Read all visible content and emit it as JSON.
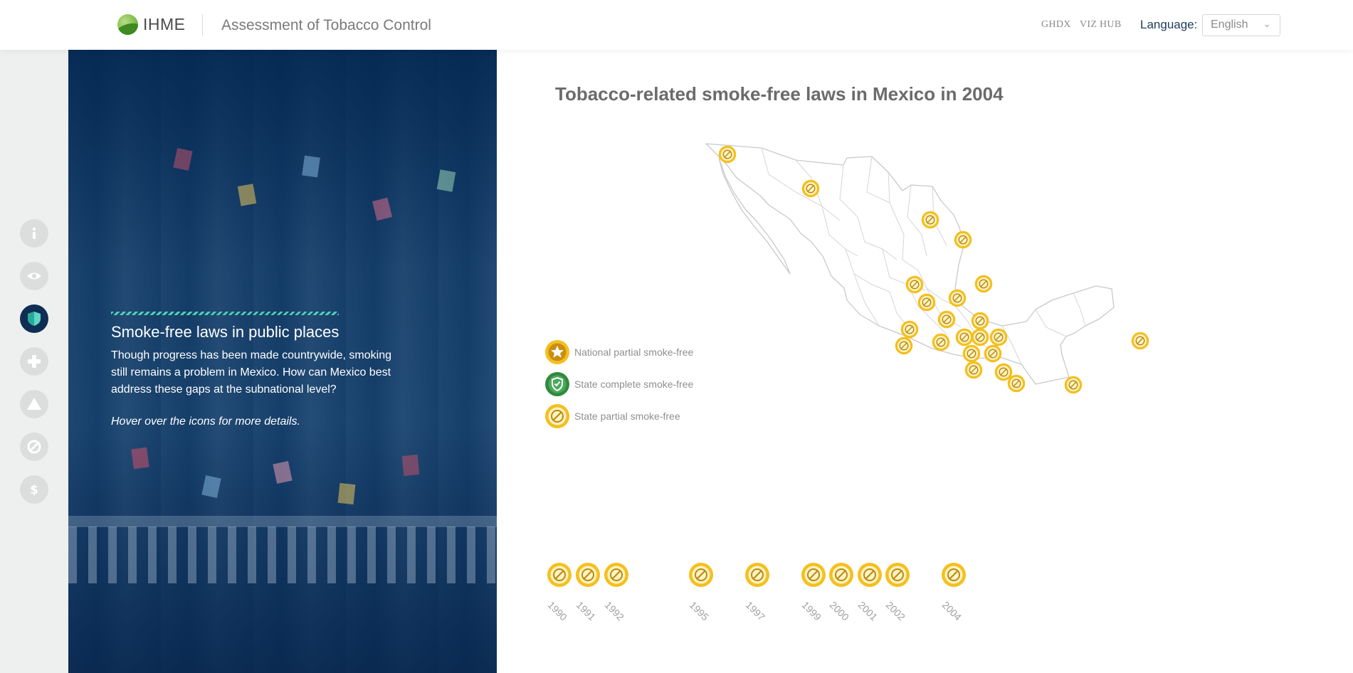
{
  "header": {
    "logo_text": "IHME",
    "app_title": "Assessment of Tobacco Control",
    "nav": [
      {
        "label": "GHDX"
      },
      {
        "label": "VIZ HUB"
      }
    ],
    "language_label": "Language:",
    "language_value": "English"
  },
  "rail": {
    "items": [
      {
        "icon": "info-icon"
      },
      {
        "icon": "eye-icon"
      },
      {
        "icon": "shield-icon",
        "active": true
      },
      {
        "icon": "plus-icon"
      },
      {
        "icon": "warning-icon"
      },
      {
        "icon": "no-smoking-icon"
      },
      {
        "icon": "dollar-icon"
      }
    ]
  },
  "story": {
    "heading": "Smoke-free laws in public places",
    "body": "Though progress has been made countrywide, smoking still remains a problem in Mexico. How can Mexico best address these gaps at the subnational level?",
    "hint": "Hover over the icons for more details."
  },
  "main": {
    "title": "Tobacco-related smoke-free laws in Mexico in 2004",
    "legend": [
      {
        "label": "National partial smoke-free",
        "icon": "star-badge-icon"
      },
      {
        "label": "State complete smoke-free",
        "icon": "shield-badge-icon"
      },
      {
        "label": "State partial smoke-free",
        "icon": "no-smoking-badge-icon"
      }
    ],
    "timeline": [
      {
        "year": "1990"
      },
      {
        "year": "1991"
      },
      {
        "year": "1992"
      },
      {
        "year": "1995"
      },
      {
        "year": "1997"
      },
      {
        "year": "1999"
      },
      {
        "year": "2000"
      },
      {
        "year": "2001"
      },
      {
        "year": "2002"
      },
      {
        "year": "2004"
      }
    ]
  },
  "colors": {
    "badge_yellow": "#f5bf1e",
    "badge_green": "#2f8a3e",
    "navy": "#0f2e54",
    "accent_teal": "#4fd0b8"
  }
}
